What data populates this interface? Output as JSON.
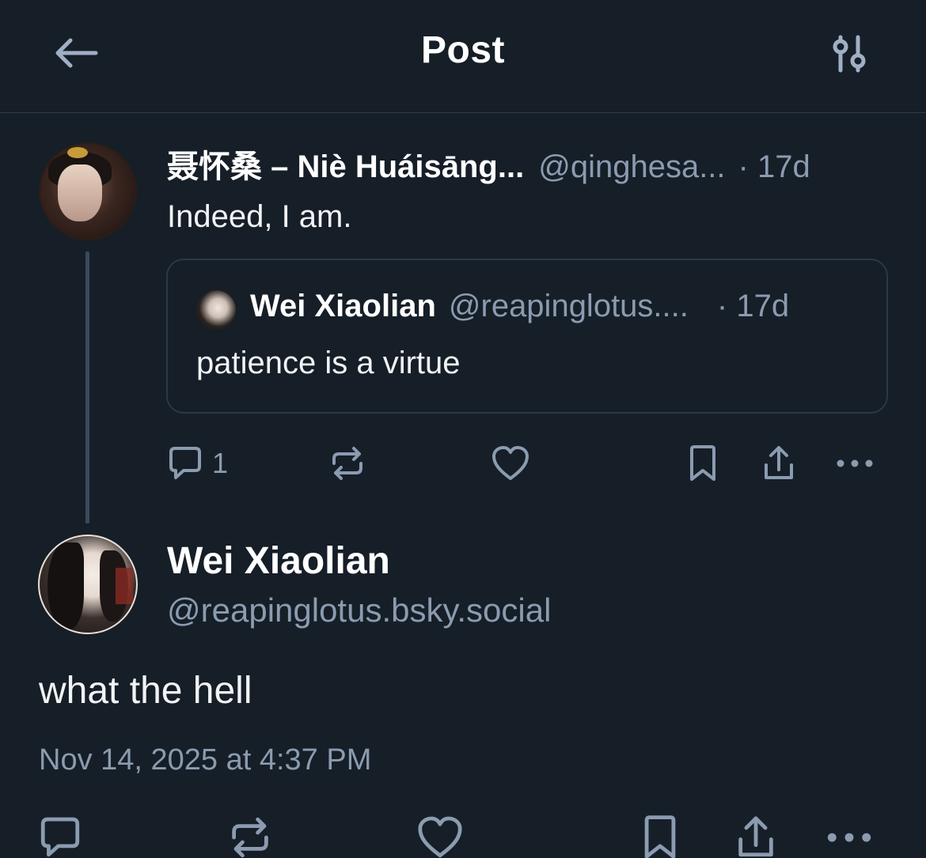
{
  "header": {
    "title": "Post",
    "back_icon": "arrow-left-icon",
    "settings_icon": "sliders-icon"
  },
  "parent_post": {
    "author_name": "聂怀桑 – Niè Huáisāng...",
    "handle": "@qinghesa...",
    "time": "· 17d",
    "text": "Indeed, I am.",
    "quote": {
      "author_name": "Wei Xiaolian",
      "handle": "@reapinglotus....",
      "time": "· 17d",
      "text": "patience is a virtue"
    },
    "actions": {
      "reply_count": "1"
    }
  },
  "main_post": {
    "author_name": "Wei Xiaolian",
    "handle": "@reapinglotus.bsky.social",
    "text": "what the hell",
    "timestamp": "Nov 14, 2025 at 4:37 PM"
  },
  "colors": {
    "background": "#161e27",
    "muted_text": "#8b9bb0",
    "primary_text": "#f1f3f5",
    "border": "#2e3b4a"
  }
}
